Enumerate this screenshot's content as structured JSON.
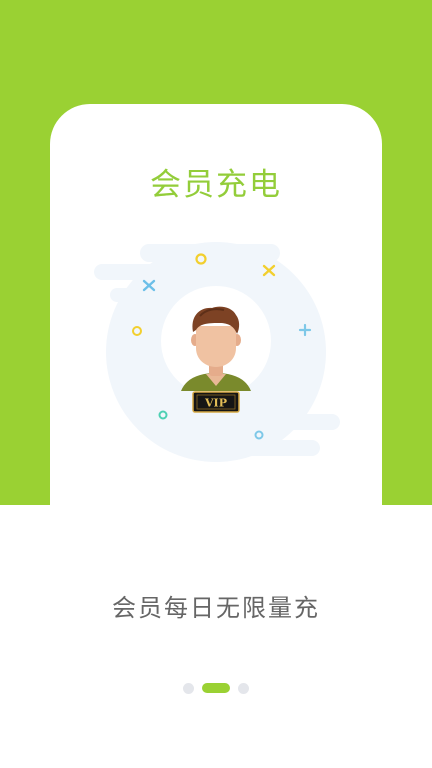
{
  "card": {
    "title": "会员充电",
    "badge_text": "VIP"
  },
  "subtitle": "会员每日无限量充",
  "pager": {
    "total": 3,
    "active_index": 1
  },
  "colors": {
    "accent": "#9ad133",
    "title": "#93cd3a",
    "subtitle": "#666666",
    "dot_inactive": "#e4e6eb"
  }
}
